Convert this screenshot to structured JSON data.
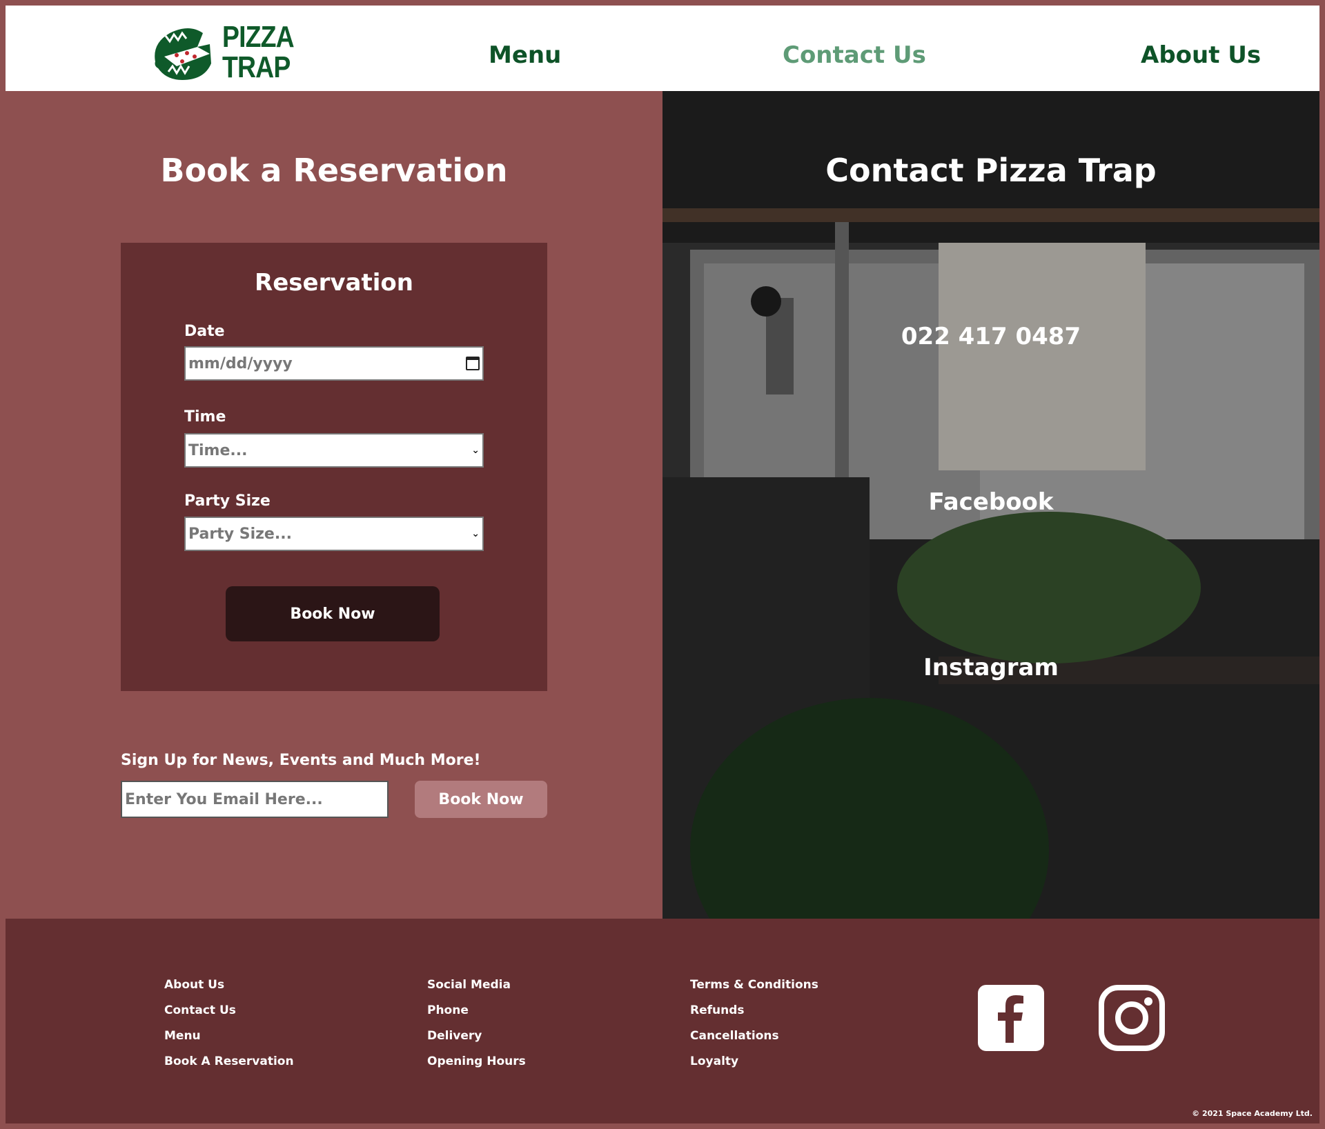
{
  "header": {
    "logo_line1": "PIZZA",
    "logo_line2": "TRAP",
    "nav": {
      "menu": "Menu",
      "contact": "Contact Us",
      "about": "About Us"
    }
  },
  "reservation": {
    "heading": "Book a Reservation",
    "card_title": "Reservation",
    "date_label": "Date",
    "date_placeholder": "mm/dd/yyyy",
    "time_label": "Time",
    "time_placeholder": "Time...",
    "party_label": "Party Size",
    "party_placeholder": "Party Size...",
    "book_button": "Book Now"
  },
  "signup": {
    "label": "Sign Up for News, Events and Much More!",
    "email_placeholder": "Enter You Email Here...",
    "button": "Book Now"
  },
  "contact": {
    "heading": "Contact Pizza Trap",
    "phone": "022 417 0487",
    "facebook": "Facebook",
    "instagram": "Instagram"
  },
  "footer": {
    "col1": [
      "About Us",
      "Contact Us",
      "Menu",
      "Book A Reservation"
    ],
    "col2": [
      "Social Media",
      "Phone",
      "Delivery",
      "Opening Hours"
    ],
    "col3": [
      "Terms & Conditions",
      "Refunds",
      "Cancellations",
      "Loyalty"
    ],
    "copyright": "© 2021 Space Academy Ltd."
  },
  "icons": {
    "logo": "pizza-trap-logo-icon",
    "calendar": "calendar-icon",
    "dropdown": "chevron-down-icon",
    "facebook": "facebook-icon",
    "instagram": "instagram-icon"
  },
  "colors": {
    "brand_green": "#0e5328",
    "active_nav": "#5e9b76",
    "page_bg": "#8e5050",
    "card_bg": "#642f31",
    "button_dark": "#2b1516",
    "button_light": "#b27b7d"
  }
}
